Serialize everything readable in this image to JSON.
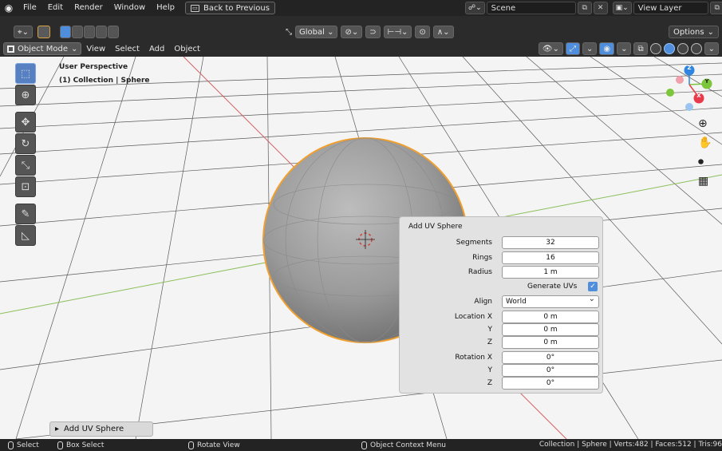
{
  "menubar": {
    "items": [
      "File",
      "Edit",
      "Render",
      "Window",
      "Help"
    ],
    "back_button": "Back to Previous",
    "scene_name": "Scene",
    "view_layer_name": "View Layer"
  },
  "header": {
    "transform_orientation": "Global",
    "options_label": "Options",
    "mode_label": "Object Mode",
    "menus": [
      "View",
      "Select",
      "Add",
      "Object"
    ]
  },
  "viewport": {
    "title": "User Perspective",
    "subtitle": "(1) Collection | Sphere",
    "gizmo_axes": {
      "z": "Z",
      "y": "Y",
      "x": "X"
    },
    "background": "#f4f4f4"
  },
  "operator_panel": {
    "title": "Add UV Sphere",
    "segments_label": "Segments",
    "segments": "32",
    "rings_label": "Rings",
    "rings": "16",
    "radius_label": "Radius",
    "radius": "1 m",
    "generate_uvs_label": "Generate UVs",
    "generate_uvs": true,
    "align_label": "Align",
    "align": "World",
    "location_x_label": "Location X",
    "location_x": "0 m",
    "location_y_label": "Y",
    "location_y": "0 m",
    "location_z_label": "Z",
    "location_z": "0 m",
    "rotation_x_label": "Rotation X",
    "rotation_x": "0°",
    "rotation_y_label": "Y",
    "rotation_y": "0°",
    "rotation_z_label": "Z",
    "rotation_z": "0°"
  },
  "adjust_last_operation": "Add UV Sphere",
  "statusbar": {
    "select": "Select",
    "box_select": "Box Select",
    "rotate_view": "Rotate View",
    "context_menu": "Object Context Menu",
    "stats": "Collection | Sphere | Verts:482 | Faces:512 | Tris:96"
  },
  "colors": {
    "accent": "#4f8edc",
    "selection_outline": "#f0a030",
    "axis_x": "#e83a4b",
    "axis_y": "#7bc63b",
    "axis_z": "#2f85e0"
  }
}
